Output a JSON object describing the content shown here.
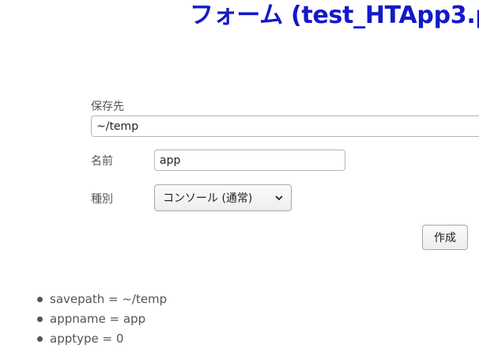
{
  "page": {
    "title": "フォーム (test_HTApp3.p"
  },
  "form": {
    "savepath": {
      "label": "保存先",
      "value": "~/temp"
    },
    "appname": {
      "label": "名前",
      "value": "app"
    },
    "apptype": {
      "label": "種別",
      "selected": "コンソール (通常)"
    },
    "submit_label": "作成"
  },
  "results": [
    "savepath = ~/temp",
    "appname = app",
    "apptype = 0"
  ],
  "colors": {
    "title": "#1419c8",
    "label": "#555555"
  },
  "icons": {
    "select_chevron": "chevron-down-icon",
    "bullet": "bullet-dot"
  }
}
